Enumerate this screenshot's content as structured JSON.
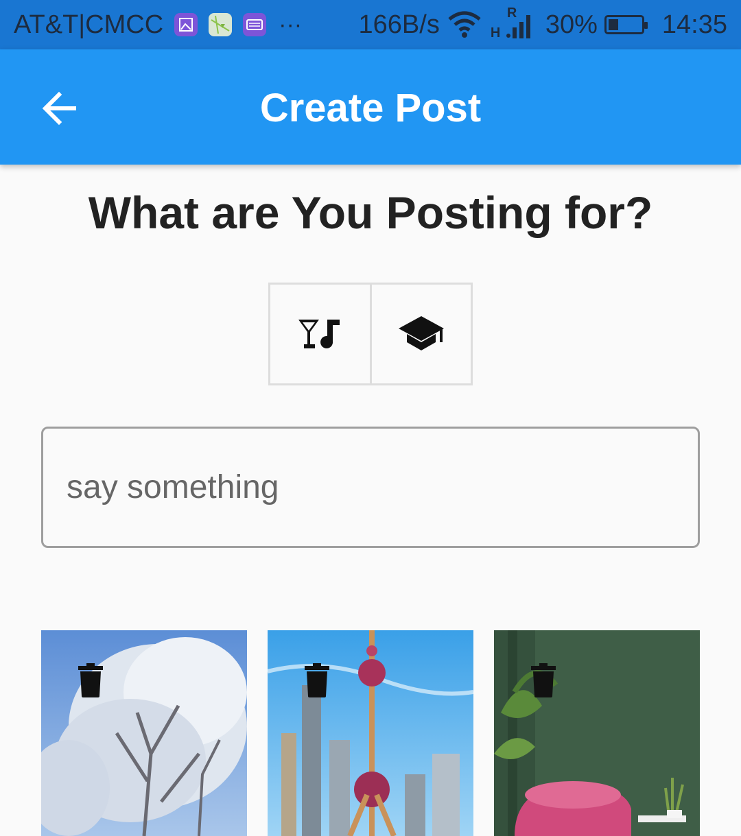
{
  "status_bar": {
    "carrier": "AT&T|CMCC",
    "more": "···",
    "speed": "166B/s",
    "network_type": "H",
    "roaming": "R",
    "battery": "30%",
    "time": "14:35",
    "icons": [
      "gallery-icon",
      "maps-icon",
      "keyboard-icon",
      "wifi-icon",
      "signal-icon",
      "battery-icon"
    ]
  },
  "app_bar": {
    "title": "Create Post",
    "back_icon": "arrow-left-icon",
    "color": "#2196f3"
  },
  "main": {
    "heading": "What are You Posting for?",
    "categories": [
      {
        "icon": "nightlife-icon"
      },
      {
        "icon": "school-icon"
      }
    ],
    "input": {
      "placeholder": "say something",
      "value": ""
    },
    "images": [
      {
        "scene": "frosted-trees-photo",
        "delete_icon": "trash-icon"
      },
      {
        "scene": "city-tower-photo",
        "delete_icon": "trash-icon"
      },
      {
        "scene": "interior-armchair-photo",
        "delete_icon": "trash-icon"
      }
    ]
  }
}
